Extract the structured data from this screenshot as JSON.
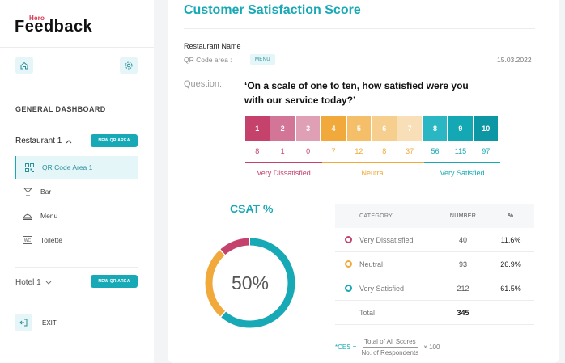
{
  "logo": {
    "small": "Hero",
    "main": "Feedback"
  },
  "sidebar": {
    "section_title": "GENERAL DASHBOARD",
    "restaurant_label": "Restaurant 1",
    "new_qr_label": "NEW QR AREA",
    "nav": [
      {
        "label": "QR Code Area 1",
        "icon": "qr-code-icon"
      },
      {
        "label": "Bar",
        "icon": "cocktail-icon"
      },
      {
        "label": "Menu",
        "icon": "cloche-icon"
      },
      {
        "label": "Toilette",
        "icon": "wc-icon"
      }
    ],
    "hotel_label": "Hotel 1",
    "hotel_new_qr_label": "NEW QR AREA",
    "exit_label": "EXIT",
    "wc_text": "WC"
  },
  "main": {
    "title": "Customer Satisfaction Score",
    "restaurant_name": "Restaurant Name",
    "qr_area_label": "QR Code area :",
    "qr_area_tag": "MENU",
    "date": "15.03.2022",
    "question_label": "Question:",
    "question_text": "‘On a scale of one to ten, how satisfied were you with our service today?’",
    "scale": [
      {
        "n": "1",
        "count": "8"
      },
      {
        "n": "2",
        "count": "1"
      },
      {
        "n": "3",
        "count": "0"
      },
      {
        "n": "4",
        "count": "7"
      },
      {
        "n": "5",
        "count": "12"
      },
      {
        "n": "6",
        "count": "8"
      },
      {
        "n": "7",
        "count": "37"
      },
      {
        "n": "8",
        "count": "56"
      },
      {
        "n": "9",
        "count": "115"
      },
      {
        "n": "10",
        "count": "97"
      }
    ],
    "groups": {
      "dissatisfied": "Very Dissatisfied",
      "neutral": "Neutral",
      "satisfied": "Very Satisfied"
    },
    "csat_title": "CSAT %",
    "csat_value": "50%",
    "csat_share": {
      "dissatisfied": 11.6,
      "neutral": 26.9,
      "satisfied": 61.5
    },
    "table": {
      "headers": {
        "category": "CATEGORY",
        "number": "NUMBER",
        "pct": "%"
      },
      "rows": [
        {
          "category": "Very Dissatisfied",
          "number": "40",
          "pct": "11.6%"
        },
        {
          "category": "Neutral",
          "number": "93",
          "pct": "26.9%"
        },
        {
          "category": "Very Satisfied",
          "number": "212",
          "pct": "61.5%"
        }
      ],
      "total_label": "Total",
      "total_value": "345"
    },
    "formula": {
      "prefix": "*CES =",
      "numerator": "Total of All Scores",
      "denominator": "No. of Respondents",
      "suffix": "× 100"
    }
  },
  "colors": {
    "accent": "#17a9b5",
    "scale": [
      "#c4426b",
      "#d27596",
      "#df9fb5",
      "#f0a93a",
      "#f4bf68",
      "#f6cf8f",
      "#f8dfb7",
      "#2ab6c3",
      "#13a8b4",
      "#0d96a3"
    ],
    "dissatisfied": "#c4426b",
    "neutral": "#f0a93a",
    "satisfied": "#17a9b5"
  }
}
